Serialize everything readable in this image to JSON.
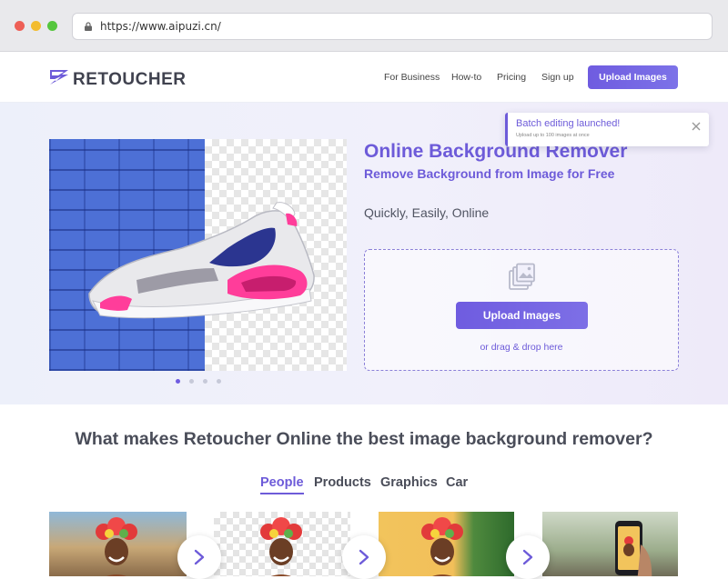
{
  "browser": {
    "url": "https://www.aipuzi.cn/"
  },
  "header": {
    "logo_text": "RETOUCHER",
    "nav": [
      "For Business",
      "How-to",
      "Pricing",
      "Sign up"
    ],
    "upload_label": "Upload Images"
  },
  "hero": {
    "title": "Online Background Remover",
    "subtitle": "Remove Background from Image for Free",
    "tagline": "Quickly, Easily, Online",
    "upload_label": "Upload Images",
    "drag_text": "or drag & drop here",
    "carousel_active_index": 0,
    "carousel_count": 4
  },
  "toast": {
    "title": "Batch editing launched!",
    "subtitle": "Upload up to 100 images at once"
  },
  "features": {
    "title": "What makes Retoucher Online the best image background remover?",
    "tabs": [
      "People",
      "Products",
      "Graphics",
      "Car"
    ],
    "active_tab": "People"
  },
  "colors": {
    "accent": "#6d5bd9",
    "button": "#6f5ce0",
    "text_dark": "#4a4d59"
  }
}
